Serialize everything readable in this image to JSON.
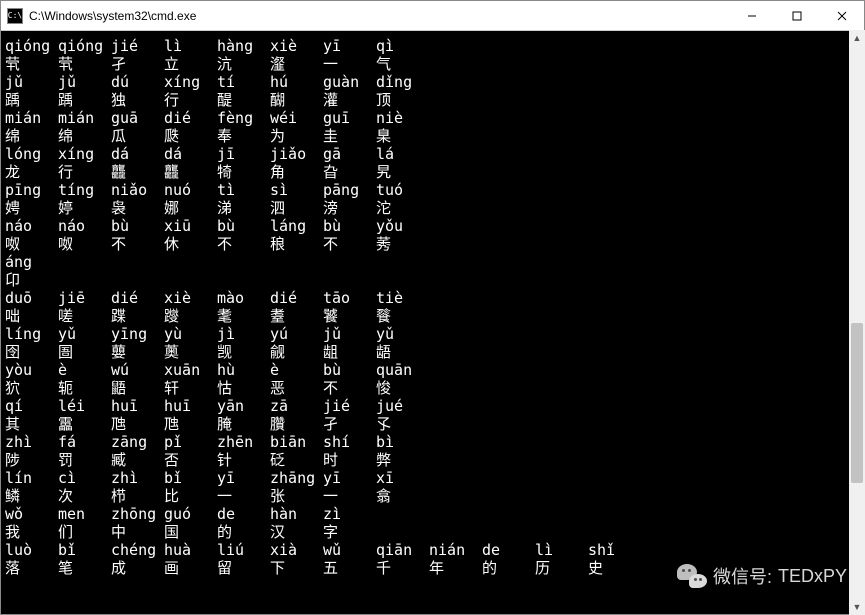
{
  "window": {
    "title": "C:\\Windows\\system32\\cmd.exe",
    "icon_label": "C:\\"
  },
  "rows": [
    [
      "qióng",
      "qióng",
      "jié",
      "lì",
      "hàng",
      "xiè",
      "yī",
      "qì"
    ],
    [
      "茕",
      "茕",
      "孑",
      "立",
      "沆",
      "瀣",
      "一",
      "气"
    ],
    [
      "jǔ",
      "jǔ",
      "dú",
      "xíng",
      "tí",
      "hú",
      "guàn",
      "dǐng"
    ],
    [
      "踽",
      "踽",
      "独",
      "行",
      "醍",
      "醐",
      "灌",
      "顶"
    ],
    [
      "mián",
      "mián",
      "guā",
      "dié",
      "fèng",
      "wéi",
      "guī",
      "niè"
    ],
    [
      "绵",
      "绵",
      "瓜",
      "瓞",
      "奉",
      "为",
      "圭",
      "臬"
    ],
    [
      "lóng",
      "xíng",
      "dá",
      "dá",
      "jī",
      "jiǎo",
      "gā",
      "lá"
    ],
    [
      "龙",
      "行",
      "龘",
      "龘",
      "犄",
      "角",
      "旮",
      "旯"
    ],
    [
      "pīng",
      "tíng",
      "niǎo",
      "nuó",
      "tì",
      "sì",
      "pāng",
      "tuó"
    ],
    [
      "娉",
      "婷",
      "袅",
      "娜",
      "涕",
      "泗",
      "滂",
      "沱"
    ],
    [
      "náo",
      "náo",
      "bù",
      "xiū",
      "bù",
      "láng",
      "bù",
      "yǒu"
    ],
    [
      "呶",
      "呶",
      "不",
      "休",
      "不",
      "稂",
      "不",
      "莠"
    ],
    [
      "áng"
    ],
    [
      "卬"
    ],
    [
      "duō",
      "jiē",
      "dié",
      "xiè",
      "mào",
      "dié",
      "tāo",
      "tiè"
    ],
    [
      "咄",
      "嗟",
      "蹀",
      "躞",
      "耄",
      "耋",
      "饕",
      "餮"
    ],
    [
      "líng",
      "yǔ",
      "yīng",
      "yù",
      "jì",
      "yú",
      "jǔ",
      "yǔ"
    ],
    [
      "囹",
      "圄",
      "蘡",
      "薁",
      "觊",
      "觎",
      "龃",
      "龉"
    ],
    [
      "yòu",
      "è",
      "wú",
      "xuān",
      "hù",
      "è",
      "bù",
      "quān"
    ],
    [
      "狖",
      "轭",
      "鼯",
      "轩",
      "怙",
      "恶",
      "不",
      "悛"
    ],
    [
      "qí",
      "léi",
      "huī",
      "huī",
      "yān",
      "zā",
      "jié",
      "jué"
    ],
    [
      "其",
      "靁",
      "虺",
      "虺",
      "腌",
      "臢",
      "孑",
      "孓"
    ],
    [
      "zhì",
      "fá",
      "zāng",
      "pǐ",
      "zhēn",
      "biān",
      "shí",
      "bì"
    ],
    [
      "陟",
      "罚",
      "臧",
      "否",
      "针",
      "砭",
      "时",
      "弊"
    ],
    [
      "lín",
      "cì",
      "zhì",
      "bǐ",
      "yī",
      "zhāng",
      "yī",
      "xī"
    ],
    [
      "鳞",
      "次",
      "栉",
      "比",
      "一",
      "张",
      "一",
      "翕"
    ],
    [
      "wǒ",
      "men",
      "zhōng",
      "guó",
      "de",
      "hàn",
      "zì"
    ],
    [
      "我",
      "们",
      "中",
      "国",
      "的",
      "汉",
      "字"
    ],
    [
      "luò",
      "bǐ",
      "chéng",
      "huà",
      "liú",
      "xià",
      "wǔ",
      "qiān",
      "nián",
      "de",
      "lì",
      "shǐ"
    ],
    [
      "落",
      "笔",
      "成",
      "画",
      "留",
      "下",
      "五",
      "千",
      "年",
      "的",
      "历",
      "史"
    ]
  ],
  "watermark": {
    "label": "微信号:",
    "value": "TEDxPY"
  }
}
